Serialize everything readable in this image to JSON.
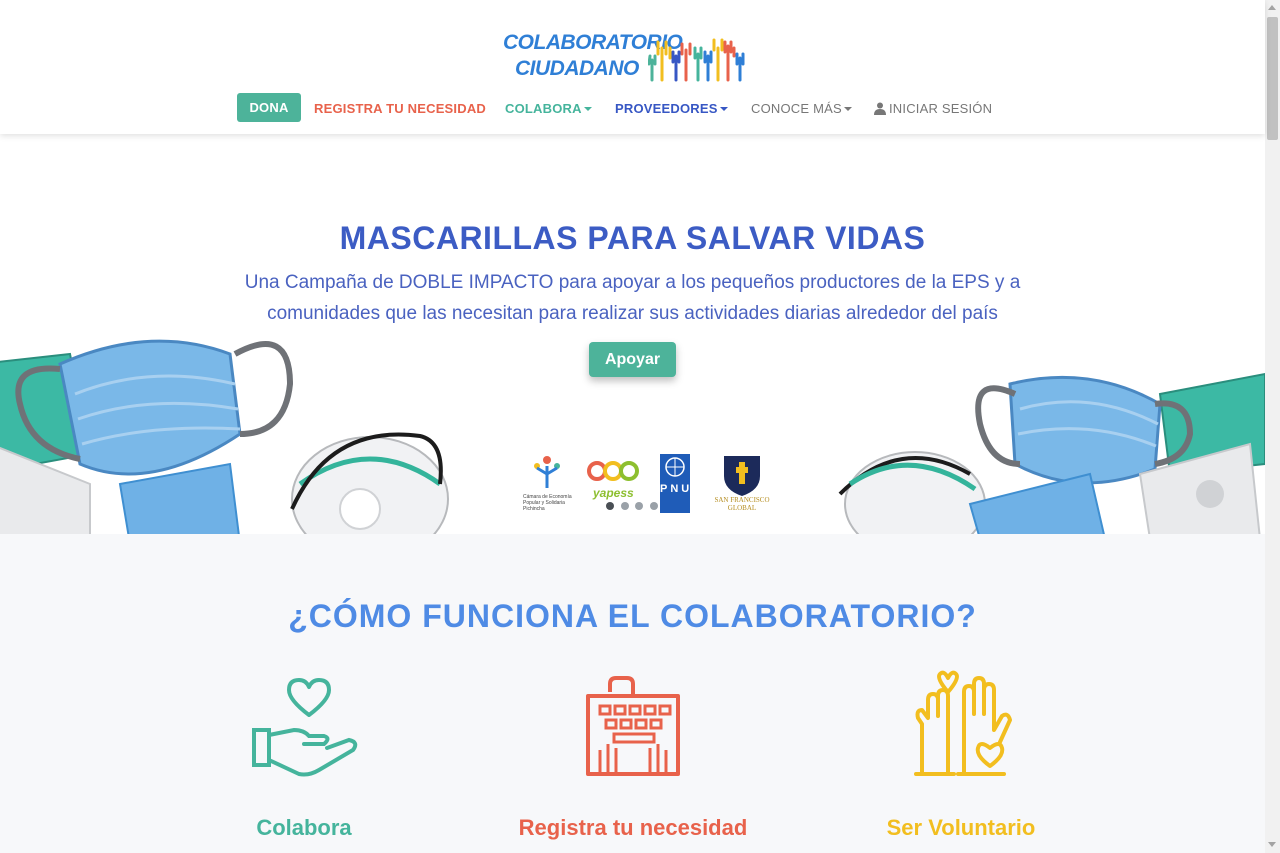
{
  "brand": {
    "line1": "COLABORATORIO",
    "line2": "CIUDADANO",
    "colors": {
      "blue": "#2f7fd6",
      "teal": "#4db39a",
      "coral": "#e8624b",
      "navy": "#3757c4",
      "yellow": "#f2be1f"
    }
  },
  "nav": {
    "dona": "DONA",
    "registra": "REGISTRA TU NECESIDAD",
    "colabora": "COLABORA",
    "proveedores": "PROVEEDORES",
    "conoce": "CONOCE MÁS",
    "login": "INICIAR SESIÓN"
  },
  "hero": {
    "title": "MASCARILLAS PARA SALVAR VIDAS",
    "subtitle": "Una Campaña de DOBLE IMPACTO para apoyar a los pequeños productores de la EPS y a comunidades que las necesitan para realizar sus actividades diarias alrededor del país",
    "cta": "Apoyar",
    "sponsors": {
      "ceps": "Cámara de Economía Popular y Solidaria Pichincha",
      "yapess": "yapess",
      "pnud": "PNUD",
      "sfg": "SAN FRANCISCO GLOBAL"
    },
    "carousel": {
      "slides": 4,
      "active": 1
    }
  },
  "how": {
    "title": "¿CÓMO FUNCIONA EL COLABORATORIO?",
    "features": [
      {
        "title": "Colabora",
        "icon": "hand-heart-icon"
      },
      {
        "title": "Registra tu necesidad",
        "icon": "keyboard-icon"
      },
      {
        "title": "Ser Voluntario",
        "icon": "raised-hands-icon"
      }
    ]
  }
}
